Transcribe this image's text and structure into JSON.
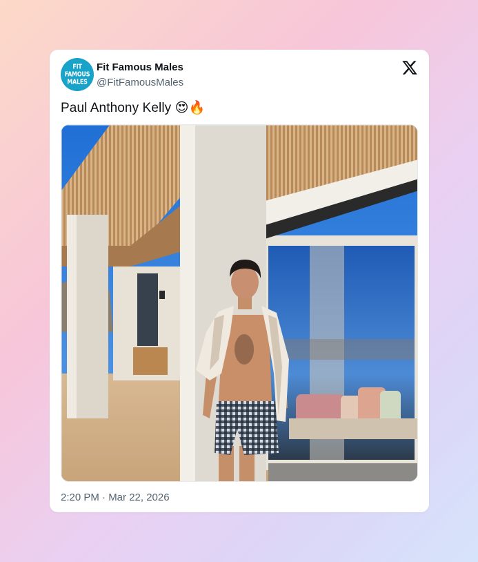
{
  "tweet": {
    "display_name": "Fit Famous Males",
    "handle": "@FitFamousMales",
    "avatar_lines": [
      "FIT",
      "FAMOUS",
      "MALES"
    ],
    "text": "Paul Anthony Kelly 😍🔥",
    "timestamp": "2:20 PM · Mar 22, 2026",
    "platform_icon": "x-logo-icon",
    "media_icon": "photo"
  },
  "colors": {
    "avatar_bg": "#1aa3c9",
    "name": "#0f1419",
    "secondary": "#536471"
  }
}
